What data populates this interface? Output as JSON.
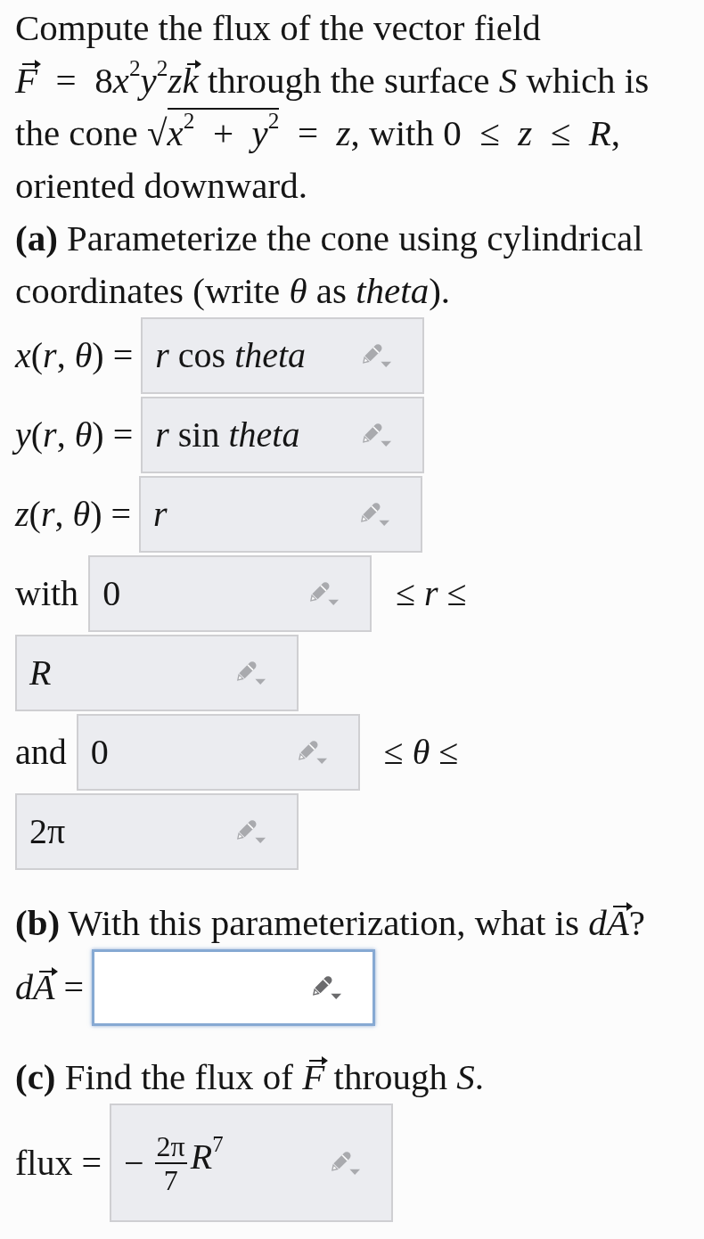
{
  "problem": {
    "segments": [
      {
        "kind": "text",
        "text": "Compute the flux of the vector field "
      },
      {
        "kind": "vector",
        "letter": "F"
      },
      {
        "kind": "text",
        "text": " = 8"
      },
      {
        "kind": "text",
        "text": "*x*$^{2}$*y*$^{2}$*z*"
      },
      {
        "kind": "vector",
        "letter": "k"
      },
      {
        "kind": "text",
        "text": " through the surface *S* which is the cone "
      },
      {
        "kind": "radical",
        "sign": "√",
        "radicand": "*x*$^{2}$ + *y*$^{2}$"
      },
      {
        "kind": "text",
        "text": " = *z*, with 0 ≤ *z* ≤ *R*, oriented downward."
      }
    ]
  },
  "part_a": {
    "prompt": "**(a)** Parameterize the cone using cylindrical coordinates (write *θ* as *theta*).",
    "components": [
      {
        "label": "*x*(*r*, *θ*) =",
        "answer": {
          "kind": "math",
          "value": "*r* cos *theta*",
          "focused": false
        }
      },
      {
        "label": "*y*(*r*, *θ*) =",
        "answer": {
          "kind": "math",
          "value": "*r* sin *theta*",
          "focused": false
        }
      },
      {
        "label": "*z*(*r*, *θ*) =",
        "answer": {
          "kind": "math",
          "value": "*r*",
          "focused": false
        }
      }
    ],
    "ranges": [
      {
        "lead": "with",
        "lower": {
          "kind": "math",
          "value": "0",
          "focused": false
        },
        "relation": "≤ *r* ≤",
        "upper": {
          "kind": "math",
          "value": "*R*",
          "focused": false
        }
      },
      {
        "lead": "and",
        "lower": {
          "kind": "math",
          "value": "0",
          "focused": false
        },
        "relation": "≤ *θ* ≤",
        "upper": {
          "kind": "math",
          "value": "2π",
          "focused": false
        }
      }
    ]
  },
  "part_b": {
    "prompt": [
      {
        "kind": "text",
        "text": "**(b)** With this parameterization, what is *d*"
      },
      {
        "kind": "vector",
        "letter": "A"
      },
      {
        "kind": "text",
        "text": "?"
      }
    ],
    "label": [
      {
        "kind": "text",
        "text": "*d*"
      },
      {
        "kind": "vector",
        "letter": "A"
      },
      {
        "kind": "text",
        "text": " ="
      }
    ],
    "answer": {
      "focused": true
    }
  },
  "part_c": {
    "prompt": [
      {
        "kind": "text",
        "text": "**(c)** Find the flux of "
      },
      {
        "kind": "vector",
        "letter": "F"
      },
      {
        "kind": "text",
        "text": " through *S*."
      }
    ],
    "label": [
      {
        "kind": "text",
        "text": "flux ="
      }
    ],
    "answer": {
      "kind": "fraction",
      "sign": "−",
      "numerator": "2π",
      "denominator": "7",
      "tail": "*R*$^{7}$",
      "focused": false
    }
  }
}
